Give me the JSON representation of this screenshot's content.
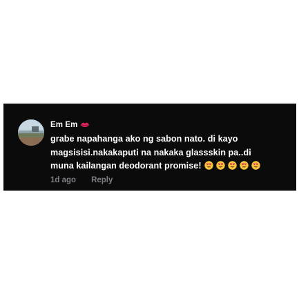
{
  "comment": {
    "author": "Em Em",
    "author_badge_icon": "kiss-lips-icon",
    "text_lines": [
      "grabe napahanga ako ng sabon nato. di kayo",
      "magsisisi.nakakaputi na nakaka glassskin pa..di",
      "muna kailangan deodorant promise!"
    ],
    "emoji_icon": "smiling-face-with-heart-eyes-icon",
    "emoji_count": 5,
    "timestamp": "1d ago",
    "reply_label": "Reply"
  },
  "colors": {
    "background": "#ffffff",
    "card_background": "#0b0b0c",
    "text": "#ffffff",
    "meta_text": "#7d7d82",
    "lips": "#e0245e"
  }
}
